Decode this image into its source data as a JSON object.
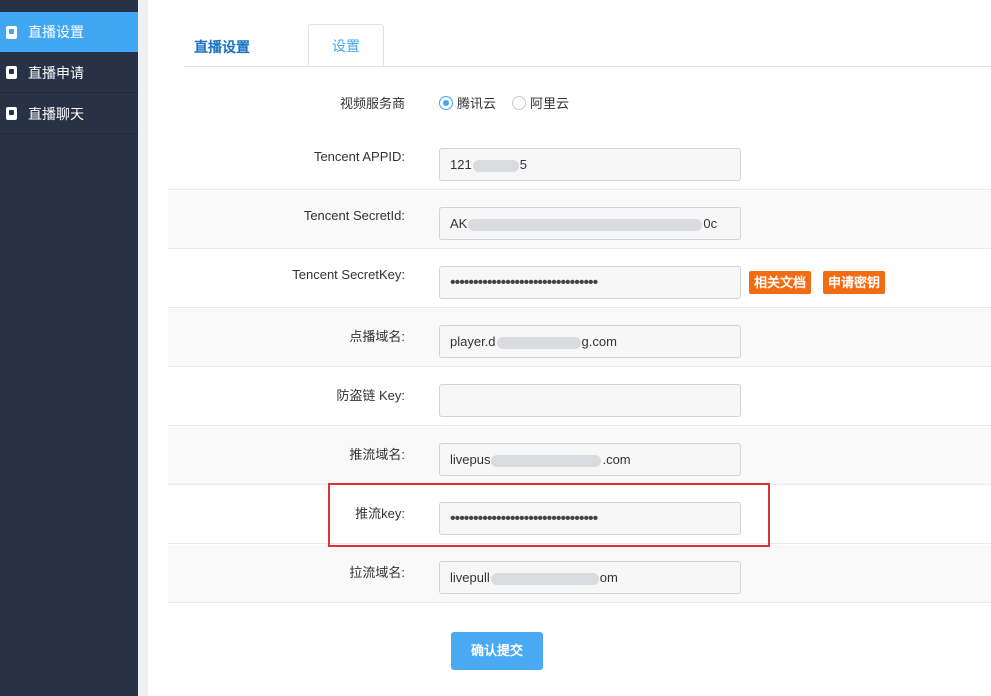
{
  "sidebar": {
    "items": [
      {
        "label": "直播设置",
        "active": true
      },
      {
        "label": "直播申请",
        "active": false
      },
      {
        "label": "直播聊天",
        "active": false
      }
    ]
  },
  "tabs": {
    "live_settings": "直播设置",
    "settings": "设置"
  },
  "form": {
    "provider": {
      "label": "视频服务商",
      "options": [
        "腾讯云",
        "阿里云"
      ],
      "selected": "腾讯云"
    },
    "appid": {
      "label": "Tencent APPID:",
      "prefix": "121",
      "suffix": "5"
    },
    "secret_id": {
      "label": "Tencent SecretId:",
      "prefix": "AK",
      "suffix": "0c"
    },
    "secret_key": {
      "label": "Tencent SecretKey:",
      "value": "••••••••••••••••••••••••••••••••",
      "doc_button": "相关文档",
      "apply_button": "申请密钥"
    },
    "vod_domain": {
      "label": "点播域名:",
      "prefix": "player.d",
      "suffix": "g.com"
    },
    "antitheft_key": {
      "label": "防盗链 Key:",
      "value": ""
    },
    "push_domain": {
      "label": "推流域名:",
      "prefix": "livepus",
      "suffix": ".com"
    },
    "push_key": {
      "label": "推流key:",
      "value": "••••••••••••••••••••••••••••••••"
    },
    "pull_domain": {
      "label": "拉流域名:",
      "prefix": "livepull",
      "suffix": "om"
    },
    "submit": "确认提交"
  },
  "colors": {
    "sidebar_bg": "#283246",
    "sidebar_active": "#3fa7f3",
    "orange_button": "#f36c11",
    "submit_button": "#4aa9f3",
    "highlight_border": "#d9323a"
  }
}
